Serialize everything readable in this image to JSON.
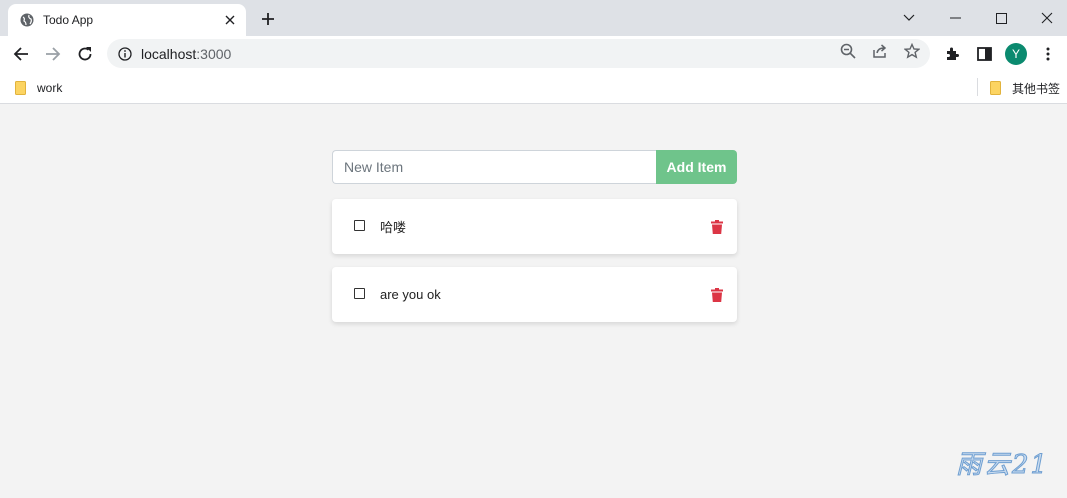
{
  "browser": {
    "tab_title": "Todo App",
    "url_host": "localhost",
    "url_port": ":3000",
    "profile_initial": "Y",
    "bookmarks": [
      {
        "label": "work"
      },
      {
        "label": "其他书签"
      }
    ]
  },
  "app": {
    "new_item_placeholder": "New Item",
    "new_item_value": "",
    "add_button_label": "Add Item",
    "todos": [
      {
        "text": "哈喽",
        "done": false
      },
      {
        "text": "are you ok",
        "done": false
      }
    ]
  },
  "watermark": "雨云21",
  "colors": {
    "accent_green": "#6fc48b",
    "delete_red": "#dc3545",
    "avatar": "#0b8a6f"
  },
  "icons": [
    "globe-icon",
    "close-icon",
    "plus-icon",
    "back-icon",
    "forward-icon",
    "reload-icon",
    "info-icon",
    "zoom-out-icon",
    "share-icon",
    "star-icon",
    "extensions-icon",
    "side-panel-icon",
    "menu-icon",
    "folder-icon",
    "trash-icon"
  ]
}
